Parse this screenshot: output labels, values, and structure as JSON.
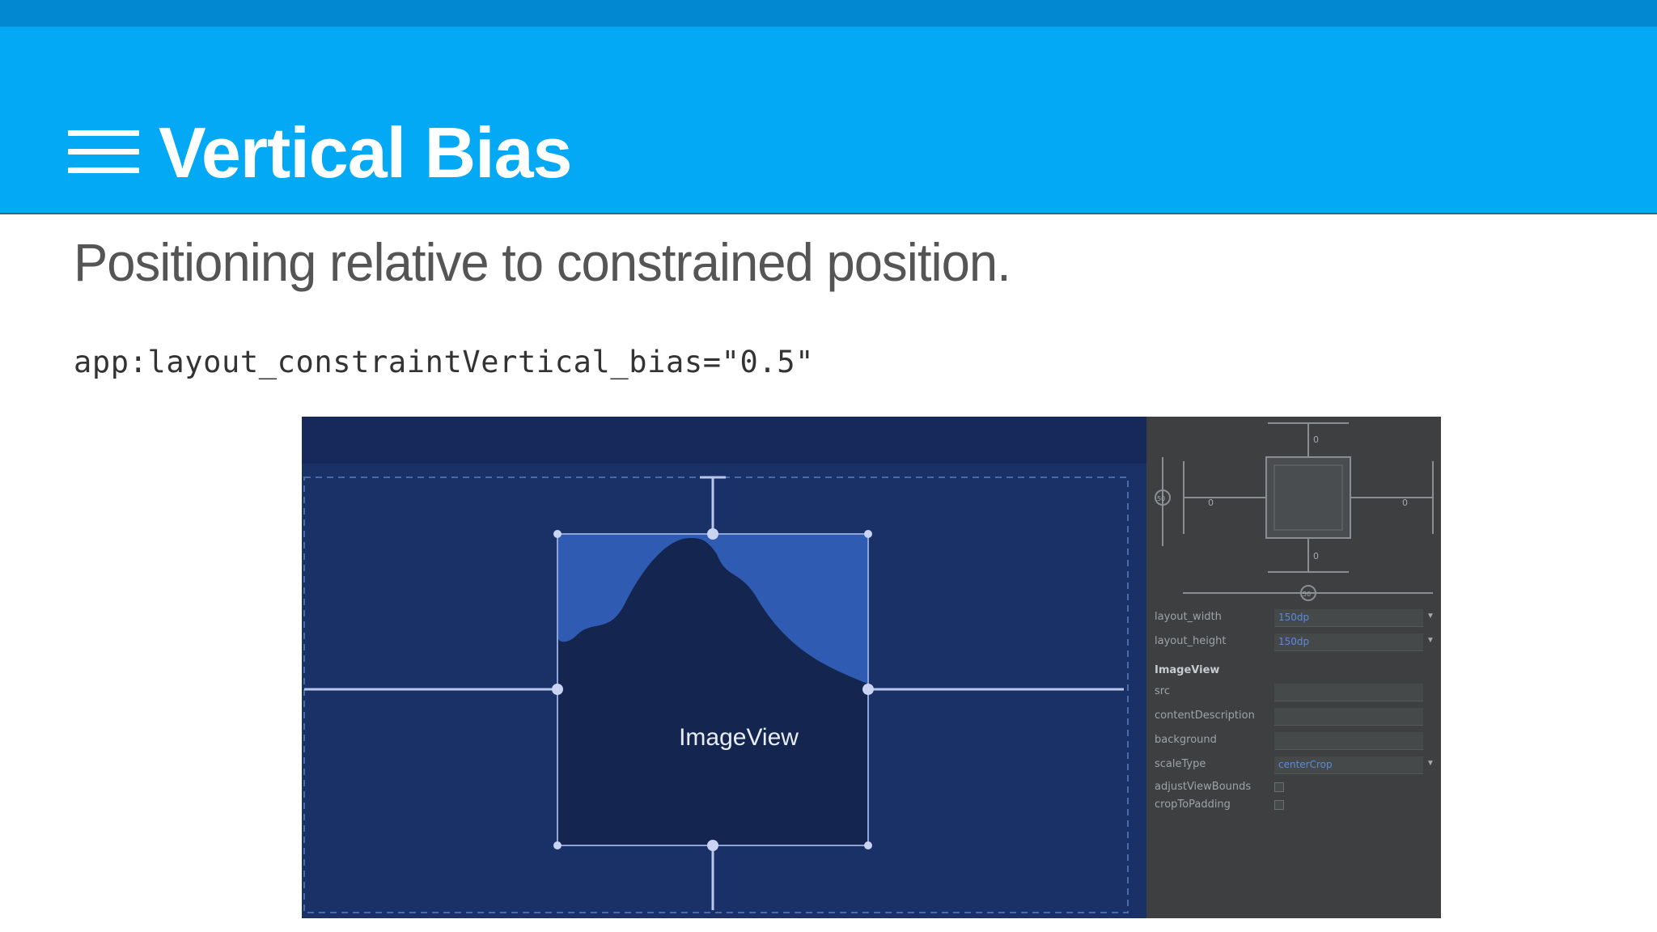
{
  "header": {
    "title": "Vertical Bias",
    "menu_icon": "hamburger-menu-icon",
    "colors": {
      "app_bar": "#03a9f4",
      "status_strip": "#0288d1"
    }
  },
  "subtitle": "Positioning relative to constrained position.",
  "code": "app:layout_constraintVertical_bias=\"0.5\"",
  "editor": {
    "image_view_label": "ImageView",
    "bias_values": {
      "top": "0",
      "left": "0",
      "right": "0",
      "bottom": "0",
      "vertical_slider": "50",
      "horizontal_slider": "50"
    },
    "attributes": [
      {
        "label": "layout_width",
        "value": "150dp",
        "kind": "dropdown"
      },
      {
        "label": "layout_height",
        "value": "150dp",
        "kind": "dropdown"
      },
      {
        "label": "ImageView",
        "value": "",
        "kind": "section"
      },
      {
        "label": "src",
        "value": "",
        "kind": "field"
      },
      {
        "label": "contentDescription",
        "value": "",
        "kind": "field"
      },
      {
        "label": "background",
        "value": "",
        "kind": "field"
      },
      {
        "label": "scaleType",
        "value": "centerCrop",
        "kind": "dropdown"
      },
      {
        "label": "adjustViewBounds",
        "value": "",
        "kind": "checkbox"
      },
      {
        "label": "cropToPadding",
        "value": "",
        "kind": "checkbox"
      }
    ]
  }
}
